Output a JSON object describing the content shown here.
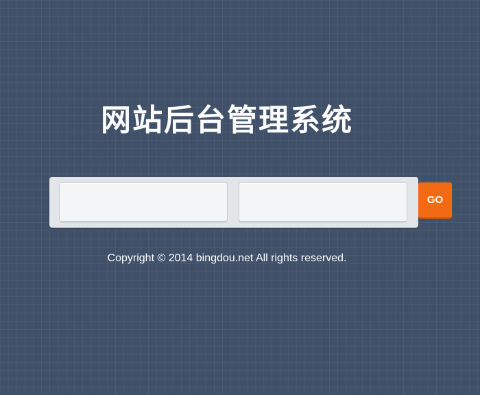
{
  "page": {
    "title": "网站后台管理系统"
  },
  "login_form": {
    "username_value": "",
    "password_value": "",
    "go_label": "GO"
  },
  "footer": {
    "copyright": "Copyright © 2014 bingdou.net All rights reserved."
  },
  "colors": {
    "background": "#3f5068",
    "go_button": "#f26a14",
    "panel": "#e3e6e9",
    "field": "#f4f5f7"
  }
}
